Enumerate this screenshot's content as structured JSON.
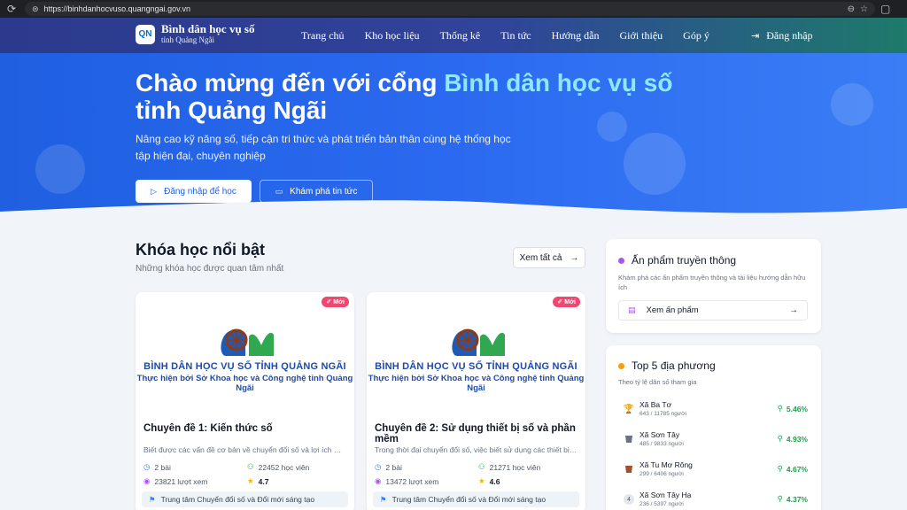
{
  "browser": {
    "url": "https://binhdanhocvuso.quangngai.gov.vn"
  },
  "nav": {
    "logo_title": "Bình dân học vụ số",
    "logo_subtitle": "tỉnh Quảng Ngãi",
    "items": [
      "Trang chủ",
      "Kho học liệu",
      "Thống kê",
      "Tin tức",
      "Hướng dẫn",
      "Giới thiệu",
      "Góp ý"
    ],
    "login": "Đăng nhập"
  },
  "hero": {
    "title_prefix": "Chào mừng đến với cổng ",
    "title_highlight": "Bình dân học vụ số",
    "title_suffix": "tỉnh Quảng Ngãi",
    "subtitle": "Nâng cao kỹ năng số, tiếp cận tri thức và phát triển bản thân cùng hệ thống học tập hiện đại, chuyên nghiệp",
    "primary_button": "Đăng nhập để học",
    "secondary_button": "Khám phá tin tức"
  },
  "featured": {
    "title": "Khóa học nổi bật",
    "subtitle": "Những khóa học được quan tâm nhất",
    "see_all": "Xem tất cả",
    "courses": [
      {
        "badge": "Mới",
        "brand_line1": "BÌNH DÂN HỌC VỤ SỐ TỈNH QUẢNG NGÃI",
        "brand_line2": "Thực hiện bởi Sở Khoa học và Công nghệ tỉnh Quảng Ngãi",
        "title": "Chuyên đề 1: Kiến thức số",
        "description": "Biết được các vấn đề cơ bản về chuyển đổi số và lợi ích mang l...",
        "lessons": "2 bài",
        "students": "22452 học viên",
        "views": "23821 lượt xem",
        "rating": "4.7",
        "organizer": "Trung tâm Chuyển đổi số và Đổi mới sáng tạo"
      },
      {
        "badge": "Mới",
        "brand_line1": "BÌNH DÂN HỌC VỤ SỐ TỈNH QUẢNG NGÃI",
        "brand_line2": "Thực hiện bởi Sở Khoa học và Công nghệ tỉnh Quảng Ngãi",
        "title": "Chuyên đề 2: Sử dụng thiết bị số và phần mềm",
        "description": "Trong thời đại chuyển đổi số, việc biết sử dụng các thiết bị và...",
        "lessons": "2 bài",
        "students": "21271 học viên",
        "views": "13472 lượt xem",
        "rating": "4.6",
        "organizer": "Trung tâm Chuyển đổi số và Đổi mới sáng tạo"
      }
    ]
  },
  "publications": {
    "title": "Ấn phẩm truyền thông",
    "description": "Khám phá các ấn phẩm truyền thông và tài liệu hướng dẫn hữu ích",
    "button": "Xem ấn phẩm",
    "dot_color": "#a855f7"
  },
  "top5": {
    "title": "Top 5 địa phương",
    "description": "Theo tỷ lệ dân số tham gia",
    "dot_color": "#f59e0b",
    "items": [
      {
        "icon": "trophy-icon",
        "name": "Xã Ba Tơ",
        "stat": "643 / 11785 người",
        "pct": "5.46%"
      },
      {
        "icon": "medal-silver-icon",
        "name": "Xã Sơn Tây",
        "stat": "485 / 9833 người",
        "pct": "4.93%"
      },
      {
        "icon": "medal-bronze-icon",
        "name": "Xã Tu Mơ Rông",
        "stat": "299 / 6406 người",
        "pct": "4.67%"
      },
      {
        "icon": "rank-4-icon",
        "rank": "4",
        "name": "Xã Sơn Tây Hạ",
        "stat": "236 / 5397 người",
        "pct": "4.37%"
      }
    ]
  }
}
